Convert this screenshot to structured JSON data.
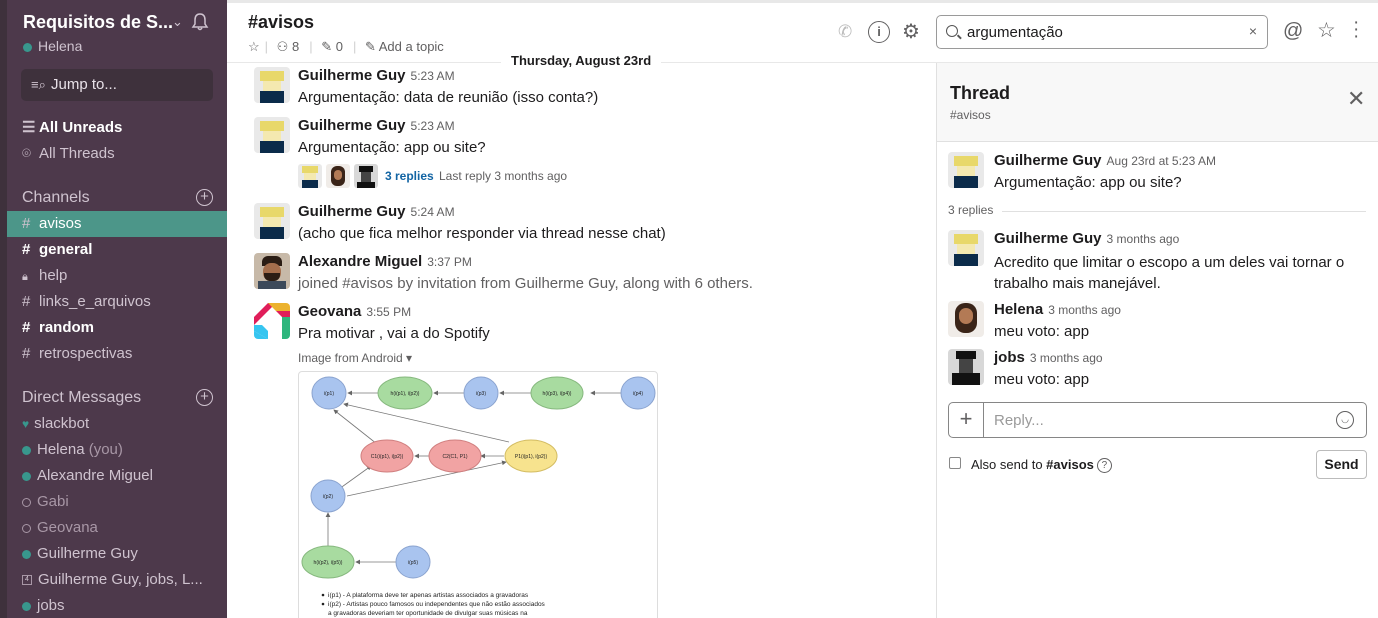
{
  "workspace": {
    "name": "Requisitos de S...",
    "user": "Helena",
    "jump_placeholder": "Jump to..."
  },
  "nav": {
    "all_unreads": "All Unreads",
    "all_threads": "All Threads"
  },
  "channels": {
    "heading": "Channels",
    "items": [
      {
        "name": "avisos",
        "state": "active"
      },
      {
        "name": "general",
        "state": "bold"
      },
      {
        "name": "help",
        "state": "private"
      },
      {
        "name": "links_e_arquivos",
        "state": "normal"
      },
      {
        "name": "random",
        "state": "bold"
      },
      {
        "name": "retrospectivas",
        "state": "normal"
      }
    ]
  },
  "dms": {
    "heading": "Direct Messages",
    "items": [
      {
        "name": "slackbot",
        "status": "heart"
      },
      {
        "name": "Helena",
        "suffix": "(you)",
        "status": "online"
      },
      {
        "name": "Alexandre Miguel",
        "status": "online"
      },
      {
        "name": "Gabi",
        "status": "away"
      },
      {
        "name": "Geovana",
        "status": "away"
      },
      {
        "name": "Guilherme Guy",
        "status": "online"
      },
      {
        "name": "Guilherme Guy, jobs, L...",
        "status": "group"
      },
      {
        "name": "jobs",
        "status": "online"
      }
    ]
  },
  "header": {
    "channel": "#avisos",
    "members": "8",
    "pins": "0",
    "add_topic": "Add a topic",
    "search_value": "argumentação",
    "clear": "×"
  },
  "date_divider": "Thursday, August 23rd",
  "messages": [
    {
      "author": "Guilherme Guy",
      "time": "5:23 AM",
      "text": "Argumentação: data de reunião (isso conta?)"
    },
    {
      "author": "Guilherme Guy",
      "time": "5:23 AM",
      "text": "Argumentação: app ou site?",
      "replies": "3 replies",
      "last_reply": "Last reply 3 months ago"
    },
    {
      "author": "Guilherme Guy",
      "time": "5:24 AM",
      "text": "(acho que fica melhor responder via thread nesse chat)"
    },
    {
      "author": "Alexandre Miguel",
      "time": "3:37 PM",
      "text": "joined #avisos by invitation from Guilherme Guy, along with 6 others."
    },
    {
      "author": "Geovana",
      "time": "3:55 PM",
      "text": "Pra motivar , vai a do Spotify",
      "attachment_label": "Image from Android ▾"
    }
  ],
  "diagram": {
    "nodes": [
      {
        "id": "n1",
        "label": "i(p1)",
        "color": "#a9c4ef"
      },
      {
        "id": "n2",
        "label": "h(i(p1), i(p2))",
        "color": "#a8dba0"
      },
      {
        "id": "n3",
        "label": "i(p3)",
        "color": "#a9c4ef"
      },
      {
        "id": "n4",
        "label": "h(i(p3), i(p4))",
        "color": "#a8dba0"
      },
      {
        "id": "n5",
        "label": "i(p4)",
        "color": "#a9c4ef"
      },
      {
        "id": "n6",
        "label": "C1(i(p1), i(p2))",
        "color": "#f1a3a3"
      },
      {
        "id": "n7",
        "label": "C2(C1, P1)",
        "color": "#f1a3a3"
      },
      {
        "id": "n8",
        "label": "P1(i(p1), i(p2))",
        "color": "#f7e38e"
      },
      {
        "id": "n9",
        "label": "i(p2)",
        "color": "#a9c4ef"
      },
      {
        "id": "n10",
        "label": "h(i(p2), i(p5))",
        "color": "#a8dba0"
      },
      {
        "id": "n11",
        "label": "i(p5)",
        "color": "#a9c4ef"
      }
    ],
    "notes": [
      "i(p1) - A plataforma deve ter apenas artistas associados a gravadoras",
      "i(p2) - Artistas pouco famosos ou independentes que não estão associados",
      "a gravadoras deveriam ter oportunidade de divulgar suas músicas na"
    ]
  },
  "thread": {
    "title": "Thread",
    "channel": "#avisos",
    "parent": {
      "author": "Guilherme Guy",
      "time": "Aug 23rd at 5:23 AM",
      "text": "Argumentação: app ou site?"
    },
    "replies_label": "3 replies",
    "replies": [
      {
        "author": "Guilherme Guy",
        "time": "3 months ago",
        "text": "Acredito que limitar o escopo a um deles vai tornar o trabalho mais manejável."
      },
      {
        "author": "Helena",
        "time": "3 months ago",
        "text": "meu voto: app"
      },
      {
        "author": "jobs",
        "time": "3 months ago",
        "text": "meu voto: app"
      }
    ],
    "reply_placeholder": "Reply...",
    "also_send": "Also send to",
    "also_send_channel": "#avisos",
    "send": "Send"
  }
}
